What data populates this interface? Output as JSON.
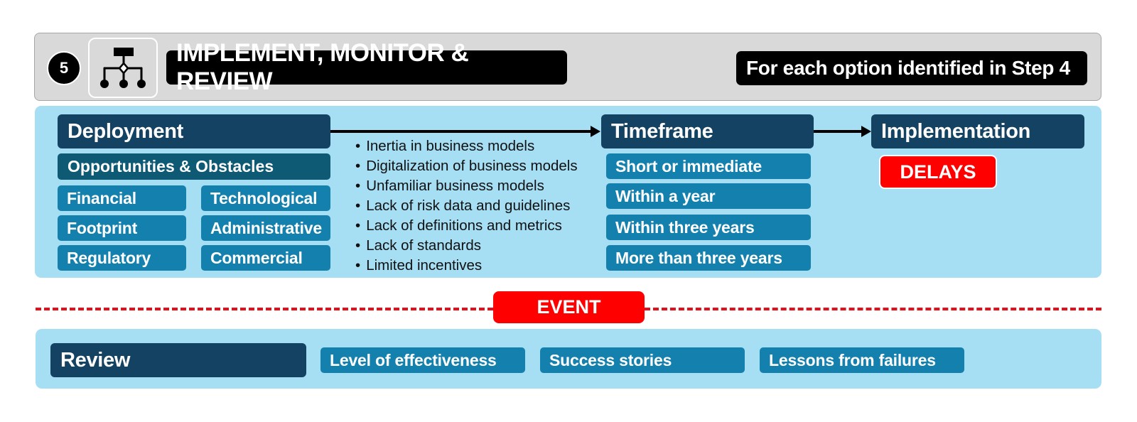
{
  "header": {
    "step_number": "5",
    "icon": "org-chart-decision-icon",
    "title": "IMPLEMENT, MONITOR & REVIEW",
    "subtitle": "For each option identified in Step 4"
  },
  "deployment": {
    "title": "Deployment",
    "subheading": "Opportunities & Obstacles",
    "categories": [
      "Financial",
      "Technological",
      "Footprint",
      "Administrative",
      "Regulatory",
      "Commercial"
    ],
    "bullets": [
      "Inertia in business models",
      "Digitalization of business models",
      "Unfamiliar business models",
      "Lack of risk data and guidelines",
      "Lack of definitions and metrics",
      "Lack of standards",
      "Limited incentives"
    ]
  },
  "timeframe": {
    "title": "Timeframe",
    "options": [
      "Short or immediate",
      "Within a year",
      "Within three years",
      "More than three years"
    ]
  },
  "implementation": {
    "title": "Implementation",
    "flag": "DELAYS"
  },
  "event": {
    "label": "EVENT"
  },
  "review": {
    "title": "Review",
    "items": [
      "Level of effectiveness",
      "Success stories",
      "Lessons from failures"
    ]
  },
  "colors": {
    "header_bg": "#d9d9d9",
    "panel_bg": "#a6def4",
    "dark_navy": "#144263",
    "teal": "#0e5a75",
    "pill_blue": "#1380ad",
    "alert_red": "#ff0000",
    "dash_red": "#e3101b"
  }
}
